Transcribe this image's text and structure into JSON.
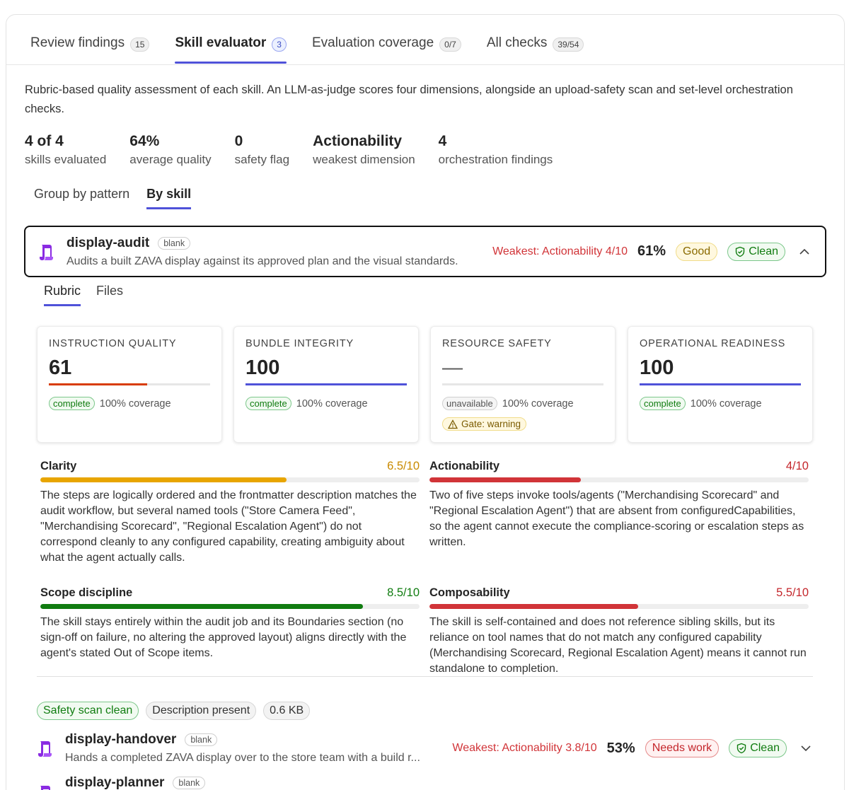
{
  "tabs": [
    {
      "label": "Review findings",
      "count": "15"
    },
    {
      "label": "Skill evaluator",
      "count": "3"
    },
    {
      "label": "Evaluation coverage",
      "count": "0/7"
    },
    {
      "label": "All checks",
      "count": "39/54"
    }
  ],
  "description": "Rubric-based quality assessment of each skill. An LLM-as-judge scores four dimensions, alongside an upload-safety scan and set-level orchestration checks.",
  "stats": [
    {
      "value": "4 of 4",
      "label": "skills evaluated"
    },
    {
      "value": "64%",
      "label": "average quality"
    },
    {
      "value": "0",
      "label": "safety flag"
    },
    {
      "value": "Actionability",
      "label": "weakest dimension"
    },
    {
      "value": "4",
      "label": "orchestration findings"
    }
  ],
  "view_tabs": [
    "Group by pattern",
    "By skill"
  ],
  "skills": [
    {
      "name": "display-audit",
      "tag": "blank",
      "description": "Audits a built ZAVA display against its approved plan and the visual standards.",
      "weakest": "Weakest: Actionability 4/10",
      "percent": "61%",
      "rating": "Good",
      "status": "Clean"
    },
    {
      "name": "display-handover",
      "tag": "blank",
      "description": "Hands a completed ZAVA display over to the store team with a build r...",
      "weakest": "Weakest: Actionability 3.8/10",
      "percent": "53%",
      "rating": "Needs work",
      "status": "Clean"
    },
    {
      "name": "display-planner",
      "tag": "blank"
    }
  ],
  "detail_tabs": [
    "Rubric",
    "Files"
  ],
  "dimensions": [
    {
      "title": "INSTRUCTION QUALITY",
      "score": "61",
      "fill": 0.61,
      "color": "#d83b01",
      "status": "complete",
      "coverage": "100% coverage"
    },
    {
      "title": "BUNDLE INTEGRITY",
      "score": "100",
      "fill": 1.0,
      "color": "#4f52d9",
      "status": "complete",
      "coverage": "100% coverage"
    },
    {
      "title": "RESOURCE SAFETY",
      "score": "—",
      "fill": 0,
      "color": "#cccccc",
      "status": "unavailable",
      "coverage": "100% coverage",
      "gate": "Gate: warning"
    },
    {
      "title": "OPERATIONAL READINESS",
      "score": "100",
      "fill": 1.0,
      "color": "#4f52d9",
      "status": "complete",
      "coverage": "100% coverage"
    }
  ],
  "criteria": [
    {
      "name": "Clarity",
      "score": "6.5/10",
      "fill": 0.65,
      "color": "#e8a500",
      "score_color": "#c98a00",
      "text": "The steps are logically ordered and the frontmatter description matches the audit workflow, but several named tools (\"Store Camera Feed\", \"Merchandising Scorecard\", \"Regional Escalation Agent\") do not correspond cleanly to any configured capability, creating ambiguity about what the agent actually calls."
    },
    {
      "name": "Actionability",
      "score": "4/10",
      "fill": 0.4,
      "color": "#d13438",
      "score_color": "#c4262b",
      "text": "Two of five steps invoke tools/agents (\"Merchandising Scorecard\" and \"Regional Escalation Agent\") that are absent from configuredCapabilities, so the agent cannot execute the compliance-scoring or escalation steps as written."
    },
    {
      "name": "Scope discipline",
      "score": "8.5/10",
      "fill": 0.85,
      "color": "#107c10",
      "score_color": "#107c10",
      "text": "The skill stays entirely within the audit job and its Boundaries section (no sign-off on failure, no altering the approved layout) aligns directly with the agent's stated Out of Scope items."
    },
    {
      "name": "Composability",
      "score": "5.5/10",
      "fill": 0.55,
      "color": "#d13438",
      "score_color": "#c4262b",
      "text": "The skill is self-contained and does not reference sibling skills, but its reliance on tool names that do not match any configured capability (Merchandising Scorecard, Regional Escalation Agent) means it cannot run standalone to completion."
    }
  ],
  "chips": [
    "Safety scan clean",
    "Description present",
    "0.6 KB"
  ],
  "icons": {
    "skill": "scroll-icon",
    "clean": "shield-check-icon",
    "expand": "chevron-up-icon",
    "collapse": "chevron-down-icon",
    "gate": "warning-icon"
  },
  "colors": {
    "accent": "#4f52d9",
    "danger": "#d13438",
    "success": "#107c10",
    "warning": "#e8a500"
  }
}
